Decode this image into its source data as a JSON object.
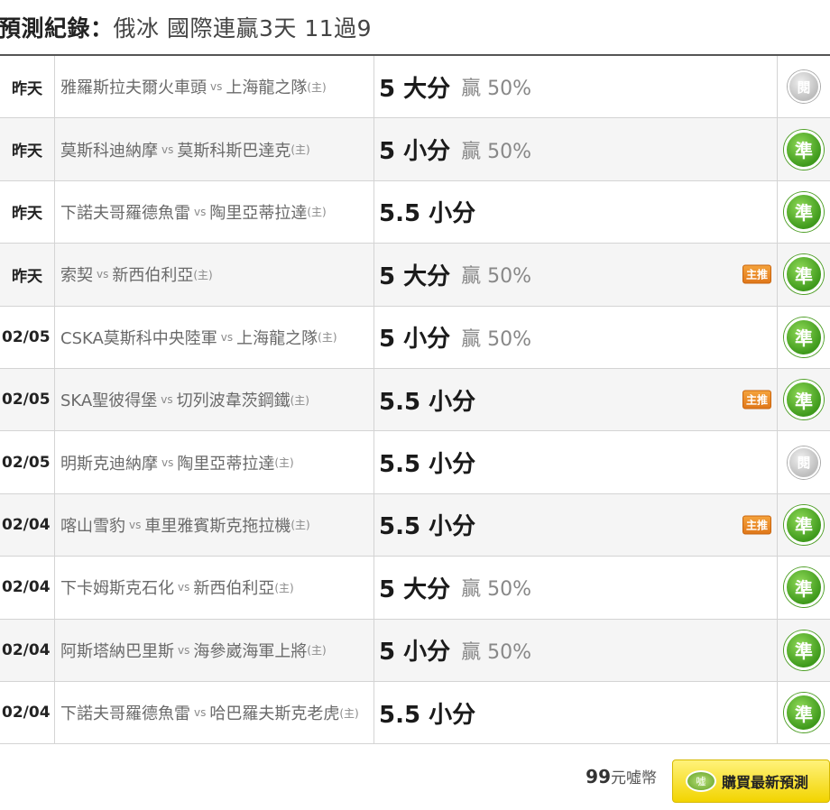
{
  "header": {
    "title_label": "預測紀錄：",
    "title_subject": "俄冰 國際連贏3天 11過9"
  },
  "rows": [
    {
      "date": "昨天",
      "home": "雅羅斯拉夫爾火車頭",
      "vs": "vs",
      "away": "上海龍之隊",
      "home_mark": "(主)",
      "pred": "5 大分",
      "result": "贏 50%",
      "badge": "",
      "status": "閱",
      "status_type": "pending"
    },
    {
      "date": "昨天",
      "home": "莫斯科迪納摩",
      "vs": "vs",
      "away": "莫斯科斯巴達克",
      "home_mark": "(主)",
      "pred": "5 小分",
      "result": "贏 50%",
      "badge": "",
      "status": "準",
      "status_type": "hit"
    },
    {
      "date": "昨天",
      "home": "下諾夫哥羅德魚雷",
      "vs": "vs",
      "away": "陶里亞蒂拉達",
      "home_mark": "(主)",
      "pred": "5.5 小分",
      "result": "",
      "badge": "",
      "status": "準",
      "status_type": "hit"
    },
    {
      "date": "昨天",
      "home": "索契",
      "vs": "vs",
      "away": "新西伯利亞",
      "home_mark": "(主)",
      "pred": "5 大分",
      "result": "贏 50%",
      "badge": "主推",
      "status": "準",
      "status_type": "hit"
    },
    {
      "date": "02/05",
      "home": "CSKA莫斯科中央陸軍",
      "vs": "vs",
      "away": "上海龍之隊",
      "home_mark": "(主)",
      "pred": "5 小分",
      "result": "贏 50%",
      "badge": "",
      "status": "準",
      "status_type": "hit"
    },
    {
      "date": "02/05",
      "home": "SKA聖彼得堡",
      "vs": "vs",
      "away": "切列波韋茨鋼鐵",
      "home_mark": "(主)",
      "pred": "5.5 小分",
      "result": "",
      "badge": "主推",
      "status": "準",
      "status_type": "hit"
    },
    {
      "date": "02/05",
      "home": "明斯克迪納摩",
      "vs": "vs",
      "away": "陶里亞蒂拉達",
      "home_mark": "(主)",
      "pred": "5.5 小分",
      "result": "",
      "badge": "",
      "status": "閱",
      "status_type": "pending"
    },
    {
      "date": "02/04",
      "home": "喀山雪豹",
      "vs": "vs",
      "away": "車里雅賓斯克拖拉機",
      "home_mark": "(主)",
      "pred": "5.5 小分",
      "result": "",
      "badge": "主推",
      "status": "準",
      "status_type": "hit"
    },
    {
      "date": "02/04",
      "home": "下卡姆斯克石化",
      "vs": "vs",
      "away": "新西伯利亞",
      "home_mark": "(主)",
      "pred": "5 大分",
      "result": "贏 50%",
      "badge": "",
      "status": "準",
      "status_type": "hit"
    },
    {
      "date": "02/04",
      "home": "阿斯塔納巴里斯",
      "vs": "vs",
      "away": "海參崴海軍上將",
      "home_mark": "(主)",
      "pred": "5 小分",
      "result": "贏 50%",
      "badge": "",
      "status": "準",
      "status_type": "hit"
    },
    {
      "date": "02/04",
      "home": "下諾夫哥羅德魚雷",
      "vs": "vs",
      "away": "哈巴羅夫斯克老虎",
      "home_mark": "(主)",
      "pred": "5.5 小分",
      "result": "",
      "badge": "",
      "status": "準",
      "status_type": "hit"
    }
  ],
  "footer": {
    "price_amount": "99",
    "price_currency": "元噓幣",
    "buy_icon_text": "噓",
    "buy_label": "購買最新預測"
  },
  "colors": {
    "hit": "#3f9a1c",
    "pending": "#bdbdbd",
    "badge": "#e0781a",
    "buy_button": "#f2d400"
  },
  "icons": {
    "hit": "green-circle-hit-icon",
    "pending": "gray-circle-pending-icon",
    "buy": "xu-coin-icon"
  }
}
